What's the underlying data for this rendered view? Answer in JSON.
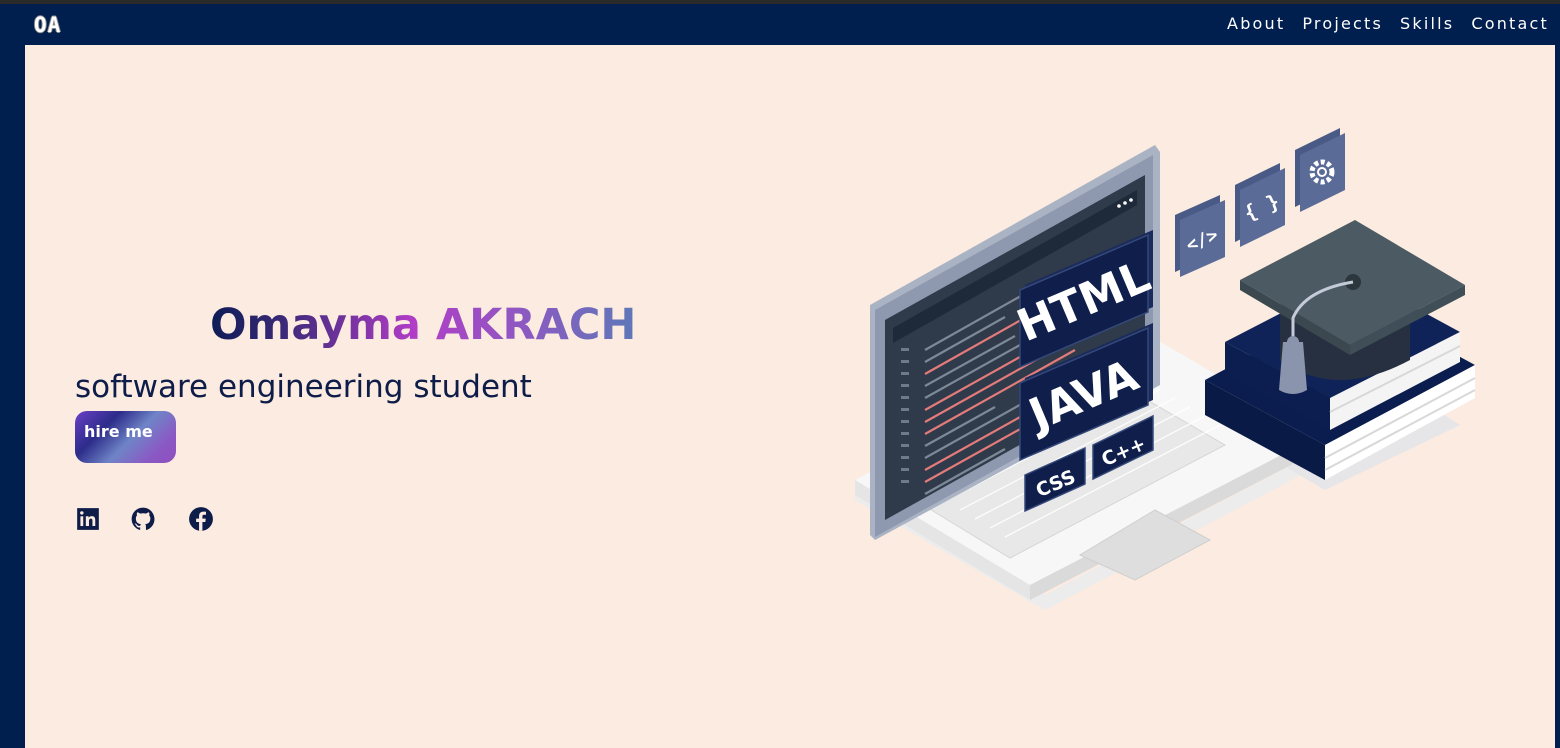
{
  "brand": {
    "logo_text": "OA"
  },
  "nav": {
    "items": [
      {
        "label": "About"
      },
      {
        "label": "Projects"
      },
      {
        "label": "Skills"
      },
      {
        "label": "Contact"
      }
    ]
  },
  "hero": {
    "name": "Omayma AKRACH",
    "subtitle": "software engineering student",
    "cta_label": "hire me",
    "socials": [
      {
        "icon": "linkedin-icon"
      },
      {
        "icon": "github-icon"
      },
      {
        "icon": "facebook-icon"
      }
    ]
  },
  "illustration": {
    "badges": [
      "HTML",
      "JAVA",
      "CSS",
      "C++"
    ],
    "small_icons": [
      "</>",
      "{ }",
      "gear-icon"
    ]
  },
  "colors": {
    "navbar_bg": "#001f4e",
    "page_bg": "#fbebe0",
    "text_dark": "#0d1c48",
    "accent_purple": "#b23dc7"
  }
}
